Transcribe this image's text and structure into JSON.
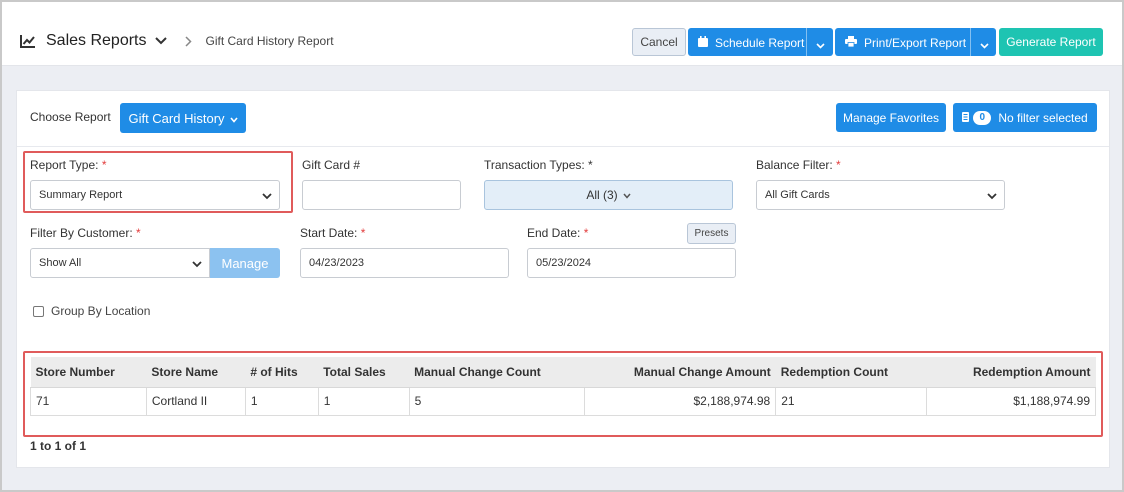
{
  "header": {
    "title": "Sales Reports",
    "breadcrumb": "Gift Card History Report",
    "cancel_label": "Cancel",
    "schedule_label": "Schedule Report",
    "print_label": "Print/Export Report",
    "generate_label": "Generate Report"
  },
  "toolbar": {
    "choose_report_label": "Choose Report",
    "report_select_label": "Gift Card History",
    "favorites_label": "Manage Favorites",
    "filter_count": "0",
    "filter_label": "No filter selected"
  },
  "filters": {
    "report_type_label": "Report Type:",
    "report_type_value": "Summary Report",
    "gift_card_label": "Gift Card #",
    "gift_card_value": "",
    "transaction_types_label": "Transaction Types: *",
    "transaction_types_value": "All (3)",
    "balance_filter_label": "Balance Filter:",
    "balance_filter_value": "All Gift Cards",
    "customer_label": "Filter By Customer:",
    "customer_value": "Show All",
    "manage_label": "Manage",
    "start_date_label": "Start Date:",
    "start_date_value": "04/23/2023",
    "end_date_label": "End Date:",
    "end_date_value": "05/23/2024",
    "presets_label": "Presets",
    "group_by_label": "Group By Location",
    "group_by_checked": false,
    "required_mark": "*"
  },
  "table": {
    "columns": [
      "Store Number",
      "Store Name",
      "# of Hits",
      "Total Sales",
      "Manual Change Count",
      "Manual Change Amount",
      "Redemption Count",
      "Redemption Amount"
    ],
    "rows": [
      [
        "71",
        "Cortland II",
        "1",
        "1",
        "5",
        "$2,188,974.98",
        "21",
        "$1,188,974.99"
      ]
    ]
  },
  "pagination": {
    "label": "1 to 1 of 1"
  },
  "colors": {
    "primary": "#1f8ce6",
    "teal": "#1ec4b2",
    "highlight": "#e05b5b",
    "required": "#e23c3c"
  }
}
